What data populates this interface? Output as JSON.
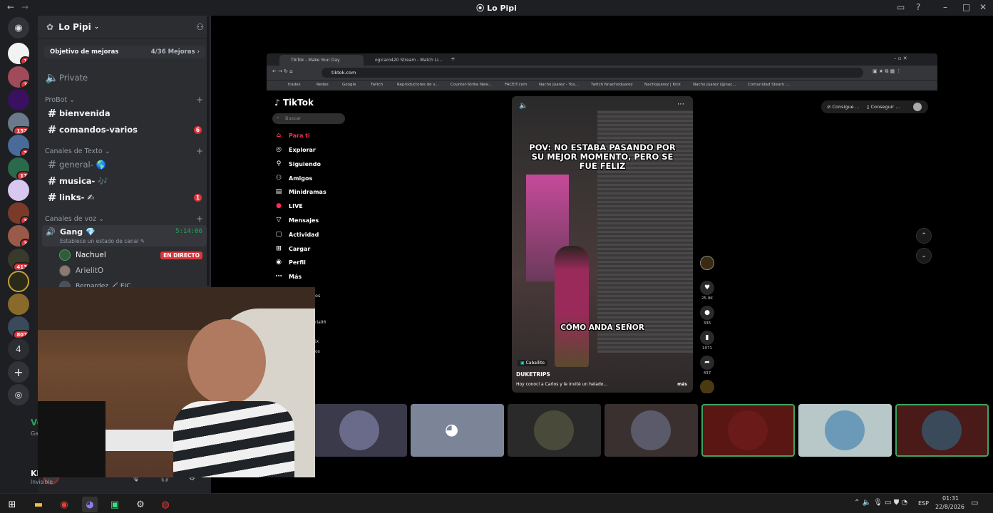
{
  "window": {
    "title": "Lo Pipi"
  },
  "server": {
    "name": "Lo Pipi",
    "boost_label": "Objetivo de mejoras",
    "boost_count": "4/36 Mejoras ›"
  },
  "guild_badges": [
    "1",
    "7",
    "152",
    "3",
    "17",
    "3",
    "3",
    "413",
    "807",
    "4"
  ],
  "channels": {
    "private": "Private",
    "cat_probot": "ProBot",
    "bienvenida": "bienvenida",
    "comandos": "comandos-varios",
    "comandos_badge": "6",
    "cat_texto": "Canales de Texto",
    "general": "general- 🌎",
    "musica": "musica- 🎶",
    "links": "links- ✍",
    "links_badge": "1",
    "cat_voz": "Canales de voz",
    "gang": "Gang 💎",
    "gang_time": "5:14:06",
    "gang_status": "Establece un estado de canal ✎",
    "users": [
      {
        "name": "Nachuel",
        "live": "EN DIRECTO"
      },
      {
        "name": "ArielitO"
      },
      {
        "name": "Bernardez 🦯 EIC"
      }
    ]
  },
  "user_panel": {
    "name": "Kl",
    "status": "Invisible",
    "voice_short": "Vo",
    "voice_sub": "Ga"
  },
  "browser": {
    "tabs": [
      "TikTok - Make Your Day",
      "ogicaro420 Stream - Watch Li..."
    ],
    "url": "tiktok.com",
    "bookmarks": [
      "trades",
      "Redes",
      "Google",
      "Twitch",
      "Reproductores de v...",
      "Counter-Strike New...",
      "FACEIT.com",
      "Nacho Juarez - You...",
      "Twitch Nnachoduarez",
      "Nachojuarez | Kick",
      "Nacho Juarez (@nac...",
      "Comunidad Steam :..."
    ]
  },
  "tiktok": {
    "logo": "TikTok",
    "search_placeholder": "Buscar",
    "nav": [
      "Para ti",
      "Explorar",
      "Siguiendo",
      "Amigos",
      "Minidramas",
      "LIVE",
      "Mensajes",
      "Actividad",
      "Cargar",
      "Perfil",
      "Más"
    ],
    "side_partial": [
      "es",
      "ria96",
      "ix",
      "os"
    ],
    "caption_top": "POV: NO ESTABA PASANDO POR SU MEJOR MOMENTO, PERO SE FUE FELIZ",
    "caption_mid": "CÓMO ANDA SEÑOR",
    "tag": "Caballito",
    "author": "DUKETRIPS",
    "desc": "Hoy conocí a Carlos y le invité un helado...",
    "more": "más",
    "likes": "25.9K",
    "comments": "335",
    "saves": "1071",
    "shares": "437",
    "btn1": "Consigue ...",
    "btn2": "Conseguir ..."
  },
  "taskbar": {
    "time": "01:31",
    "date": "22/8/2026",
    "lang": "ESP"
  }
}
